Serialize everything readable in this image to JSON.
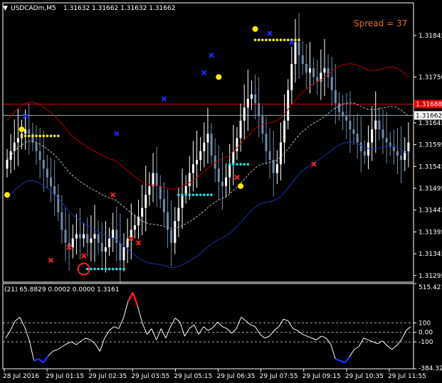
{
  "header": {
    "symbol": "USDCADm,M5",
    "ohlc": "1.31632 1.31662 1.31632 1.31662"
  },
  "spread": "Spread = 37",
  "indicator_header": "(21) 65.8829 0.0002 0.0000 1.3161",
  "colors": {
    "background": "#000000",
    "bull_candle": "#ffffff",
    "bear_candle": "#6f8aa8",
    "ma_upper": "#b30000",
    "ma_middle": "#b8b8b8",
    "ma_lower": "#1a2fae",
    "resistance_line": "#d80000",
    "bid_line": "#9aa6b5",
    "signal_yellow": "#ffee00",
    "signal_cyan": "#22dcdc",
    "cross_blue": "#1a2bff",
    "cross_red": "#ff2020",
    "spread_text": "#e07020",
    "cci_line": "#ffffff",
    "cci_hot": "#ff1a1a",
    "cci_cold": "#1a2bff"
  },
  "price_axis": {
    "ticks": [
      "1.31845",
      "1.31750",
      "1.31645",
      "1.31595",
      "1.31545",
      "1.31495",
      "1.31445",
      "1.31395",
      "1.31345",
      "1.31295"
    ],
    "resistance_tag": "1.31688",
    "bid_tag": "1.31662"
  },
  "indicator_axis": {
    "ticks": [
      "515.4210",
      "100",
      "0.00",
      "-100",
      "-384.3295"
    ]
  },
  "time_axis": {
    "ticks": [
      "28 Jul 2016",
      "29 Jul 01:15",
      "29 Jul 02:35",
      "29 Jul 03:55",
      "29 Jul 05:15",
      "29 Jul 06:35",
      "29 Jul 07:55",
      "29 Jul 09:15",
      "29 Jul 10:35",
      "29 Jul 11:55"
    ]
  },
  "chart_data": [
    {
      "type": "candlestick",
      "title": "USDCADm,M5",
      "ylim": [
        1.3128,
        1.3192
      ],
      "series": [
        {
          "name": "close",
          "values": [
            1.3156,
            1.3158,
            1.316,
            1.3161,
            1.3162,
            1.3163,
            1.3162,
            1.316,
            1.3158,
            1.3156,
            1.3154,
            1.3152,
            1.315,
            1.3148,
            1.3144,
            1.314,
            1.3137,
            1.3136,
            1.3138,
            1.3139,
            1.3138,
            1.3139,
            1.3137,
            1.3138,
            1.3139,
            1.3137,
            1.3135,
            1.3136,
            1.3138,
            1.314,
            1.3137,
            1.3133,
            1.3136,
            1.3138,
            1.314,
            1.3141,
            1.3143,
            1.3145,
            1.3148,
            1.315,
            1.3153,
            1.315,
            1.3147,
            1.3144,
            1.314,
            1.3137,
            1.3142,
            1.3145,
            1.3148,
            1.315,
            1.3153,
            1.3155,
            1.3156,
            1.3158,
            1.316,
            1.3162,
            1.3157,
            1.3154,
            1.3151,
            1.315,
            1.3152,
            1.3155,
            1.3158,
            1.3161,
            1.3165,
            1.3168,
            1.317,
            1.3171,
            1.3169,
            1.3166,
            1.3162,
            1.3158,
            1.3156,
            1.3153,
            1.3155,
            1.316,
            1.3165,
            1.3172,
            1.3178,
            1.3183,
            1.318,
            1.3178,
            1.3176,
            1.3177,
            1.3175,
            1.3174,
            1.3176,
            1.3177,
            1.3175,
            1.3172,
            1.3169,
            1.3167,
            1.3166,
            1.3165,
            1.3163,
            1.3162,
            1.316,
            1.3158,
            1.3157,
            1.316,
            1.3163,
            1.3165,
            1.3163,
            1.3161,
            1.316,
            1.3159,
            1.3158,
            1.3157,
            1.3156,
            1.3158,
            1.316
          ]
        }
      ]
    },
    {
      "type": "line",
      "title": "(21)",
      "ylim": [
        -384.3295,
        515.421
      ],
      "series": [
        {
          "name": "cci",
          "values": [
            -60,
            20,
            120,
            160,
            60,
            -80,
            -300,
            -280,
            -320,
            -250,
            -200,
            -180,
            -150,
            -120,
            -100,
            -130,
            -90,
            -60,
            -80,
            -120,
            -200,
            -60,
            20,
            60,
            40,
            150,
            330,
            420,
            280,
            100,
            -20,
            40,
            -80,
            40,
            -60,
            60,
            150,
            110,
            -40,
            40,
            80,
            -20,
            60,
            20,
            50,
            110,
            60,
            40,
            -10,
            40,
            160,
            120,
            80,
            60,
            -20,
            -60,
            -40,
            20,
            60,
            140,
            120,
            40,
            20,
            -20,
            -40,
            -60,
            -80,
            -40,
            -60,
            -120,
            -280,
            -300,
            -320,
            -260,
            -180,
            -150,
            -60,
            -80,
            -100,
            -120,
            -90,
            -140,
            -180,
            -140,
            -80,
            20,
            60
          ]
        }
      ]
    }
  ]
}
